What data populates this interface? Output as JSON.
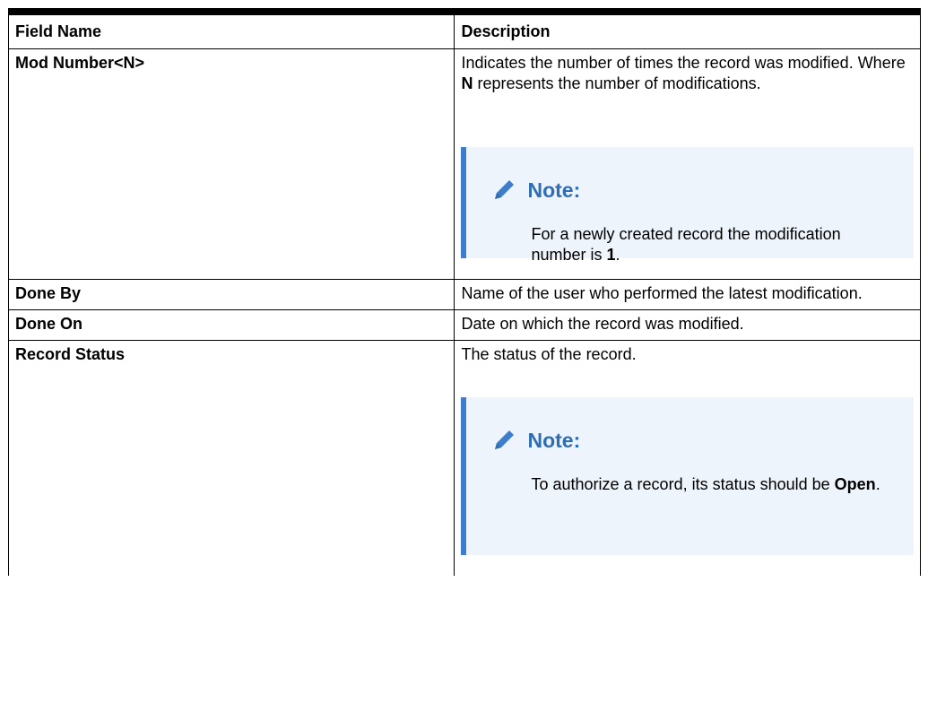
{
  "table": {
    "headers": {
      "field": "Field Name",
      "description": "Description"
    },
    "rows": [
      {
        "field": "Mod Number<N>",
        "desc_parts": [
          "Indicates the number of times the record was modified. Where ",
          "N",
          " represents the number of modifications."
        ],
        "note": {
          "title": "Note:",
          "body_parts": [
            "For a newly created record the modification number is ",
            "1",
            "."
          ]
        }
      },
      {
        "field": "Done By",
        "desc": "Name of the user who performed the latest modification."
      },
      {
        "field": "Done On",
        "desc": "Date on which the record was modified."
      },
      {
        "field": "Record Status",
        "desc": "The status of the record.",
        "note": {
          "title": "Note:",
          "body_parts": [
            "To authorize a record, its status should be ",
            "Open",
            "."
          ]
        }
      }
    ]
  },
  "colors": {
    "note_accent": "#3d7dca",
    "note_background": "#eef4fb",
    "note_title": "#2f6db5"
  },
  "icons": {
    "note": "pencil-icon"
  }
}
